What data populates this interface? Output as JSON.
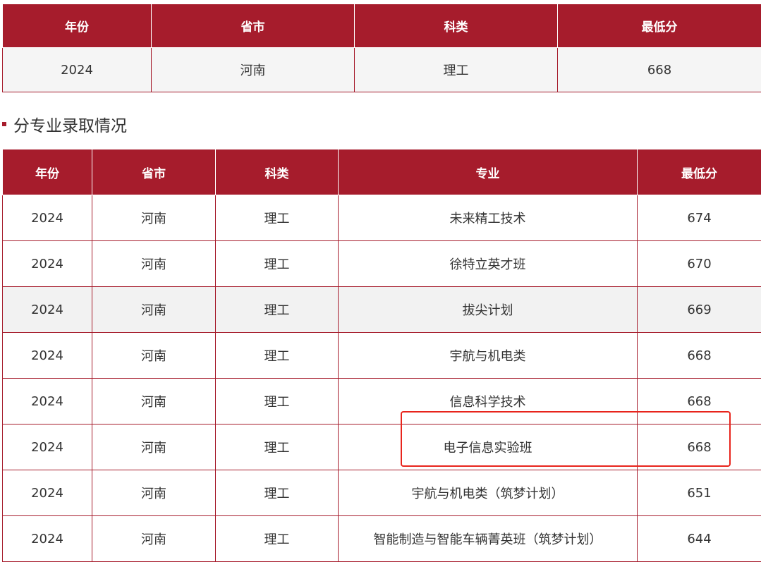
{
  "summary": {
    "headers": [
      "年份",
      "省市",
      "科类",
      "最低分"
    ],
    "row": [
      "2024",
      "河南",
      "理工",
      "668"
    ]
  },
  "section": {
    "title": "分专业录取情况"
  },
  "majors": {
    "headers": [
      "年份",
      "省市",
      "科类",
      "专业",
      "最低分"
    ],
    "rows": [
      [
        "2024",
        "河南",
        "理工",
        "未来精工技术",
        "674"
      ],
      [
        "2024",
        "河南",
        "理工",
        "徐特立英才班",
        "670"
      ],
      [
        "2024",
        "河南",
        "理工",
        "拔尖计划",
        "669"
      ],
      [
        "2024",
        "河南",
        "理工",
        "宇航与机电类",
        "668"
      ],
      [
        "2024",
        "河南",
        "理工",
        "信息科学技术",
        "668"
      ],
      [
        "2024",
        "河南",
        "理工",
        "电子信息实验班",
        "668"
      ],
      [
        "2024",
        "河南",
        "理工",
        "宇航与机电类（筑梦计划）",
        "651"
      ],
      [
        "2024",
        "河南",
        "理工",
        "智能制造与智能车辆菁英班（筑梦计划）",
        "644"
      ]
    ]
  },
  "colors": {
    "header_bg": "#a61c2c",
    "highlight_border": "#e8241c"
  }
}
